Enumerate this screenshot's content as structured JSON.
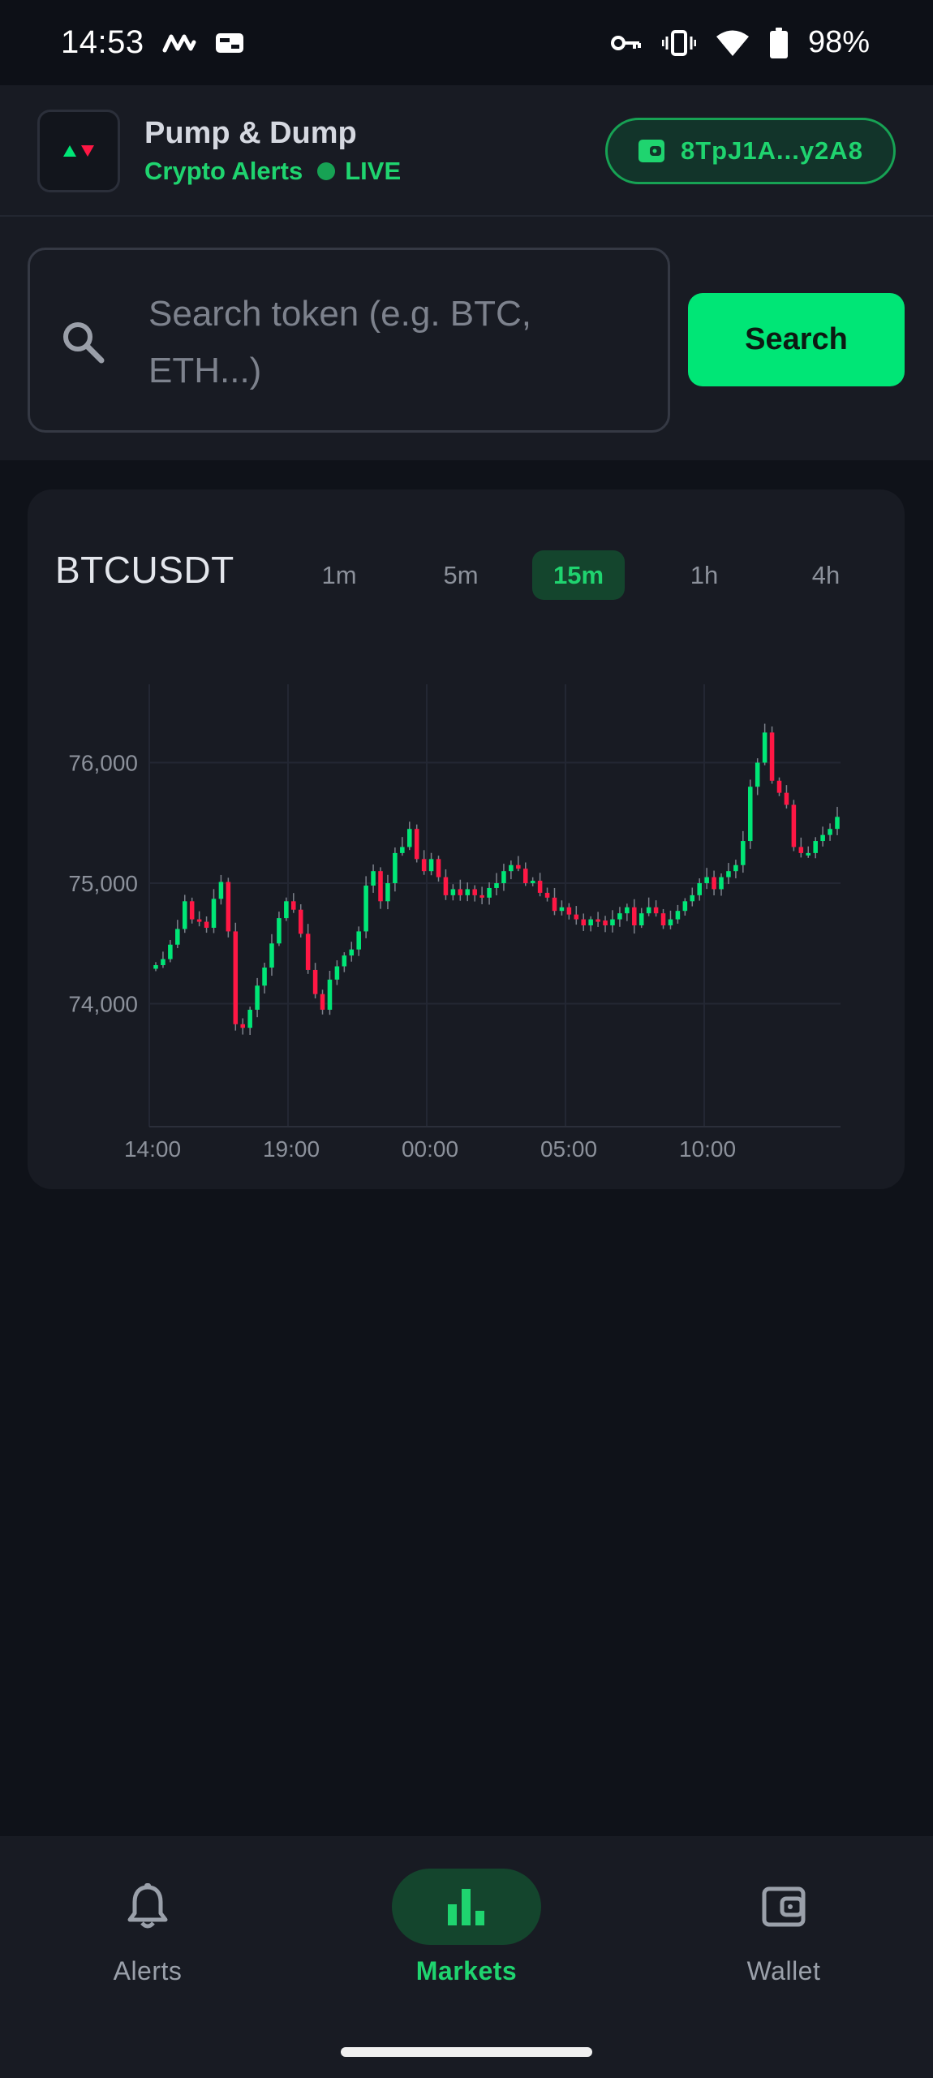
{
  "status_bar": {
    "time": "14:53",
    "battery": "98%",
    "icons": [
      "app-m-icon",
      "payment-card-icon",
      "vpn-key-icon",
      "vibrate-icon",
      "wifi-icon",
      "battery-icon"
    ]
  },
  "header": {
    "app_title": "Pump & Dump",
    "subtitle": "Crypto Alerts",
    "live_label": "LIVE",
    "wallet_address": "8TpJ1A...y2A8"
  },
  "search": {
    "placeholder": "Search token (e.g. BTC, ETH...)",
    "value": "",
    "button_label": "Search"
  },
  "chart": {
    "symbol": "BTCUSDT",
    "timeframes": [
      "1m",
      "5m",
      "15m",
      "1h",
      "4h"
    ],
    "active_timeframe": "15m"
  },
  "chart_data": {
    "type": "candlestick",
    "title": "BTCUSDT",
    "interval": "15m",
    "x_tick_labels": [
      "14:00",
      "19:00",
      "00:00",
      "05:00",
      "10:00"
    ],
    "y_tick_labels": [
      "76,000",
      "75,000",
      "74,000"
    ],
    "y_ticks": [
      76000,
      75000,
      74000
    ],
    "ylim": [
      72980,
      76650
    ],
    "grid": true,
    "up_color": "#00e676",
    "down_color": "#ff1744",
    "closes": [
      74320,
      74370,
      74490,
      74620,
      74850,
      74700,
      74680,
      74630,
      74870,
      75010,
      74600,
      73830,
      73800,
      73950,
      74150,
      74300,
      74500,
      74710,
      74850,
      74780,
      74580,
      74280,
      74080,
      73950,
      74200,
      74310,
      74400,
      74450,
      74600,
      74980,
      75100,
      74850,
      75000,
      75250,
      75300,
      75450,
      75200,
      75100,
      75200,
      75050,
      74900,
      74950,
      74900,
      74950,
      74900,
      74880,
      74960,
      75000,
      75100,
      75150,
      75120,
      75000,
      75020,
      74920,
      74880,
      74770,
      74800,
      74740,
      74700,
      74650,
      74700,
      74690,
      74650,
      74700,
      74750,
      74800,
      74650,
      74750,
      74800,
      74750,
      74650,
      74700,
      74770,
      74850,
      74900,
      75000,
      75050,
      74950,
      75050,
      75100,
      75150,
      75350,
      75800,
      76000,
      76250,
      75850,
      75750,
      75650,
      75300,
      75250,
      75250,
      75350,
      75400,
      75450,
      75550
    ]
  },
  "nav": {
    "items": [
      {
        "label": "Alerts",
        "icon": "bell-icon"
      },
      {
        "label": "Markets",
        "icon": "bar-chart-icon"
      },
      {
        "label": "Wallet",
        "icon": "wallet-icon"
      }
    ],
    "active": "Markets"
  },
  "colors": {
    "accent": "#00e676",
    "accent_text": "#1fd46f",
    "background": "#0f1219",
    "surface": "#181b23",
    "down": "#ff1744"
  }
}
